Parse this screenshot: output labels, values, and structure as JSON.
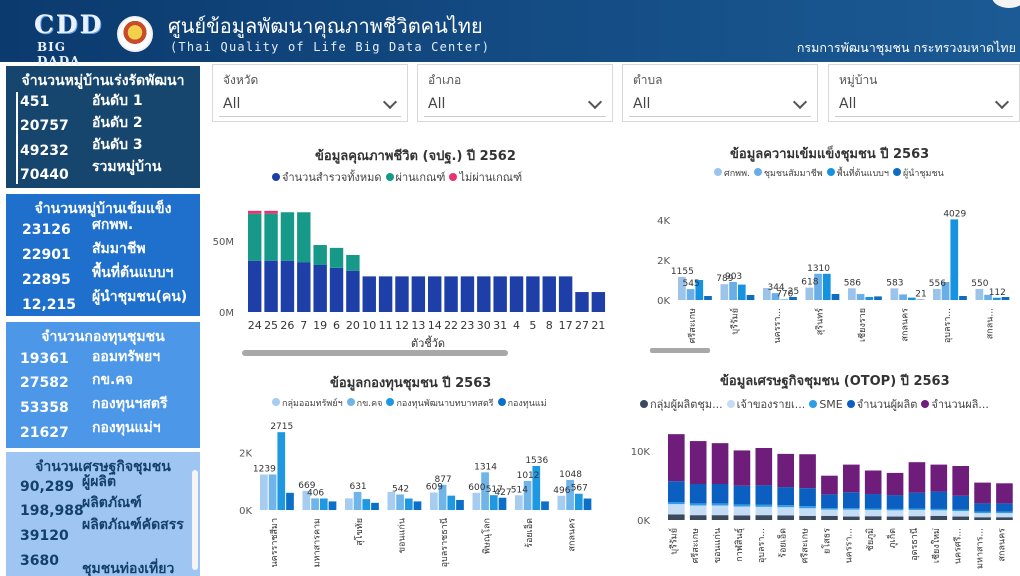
{
  "header": {
    "logo_text": "CDD",
    "logo_sub": "BIG DADA",
    "title": "ศูนย์ข้อมูลพัฒนาคุณภาพชีวิตคนไทย",
    "subtitle": "(Thai Quality of Life Big Data Center)",
    "department": "กรมการพัฒนาชุมชน กระทรวงมหาดไทย",
    "colors": {
      "header_bg": "#0b3a6e",
      "panel1": "#16456d",
      "panel2": "#1f6fcd",
      "panel3": "#4d97e8",
      "panel4": "#9fc6f2"
    }
  },
  "panels": [
    {
      "title": "จำนวนหมู่บ้านเร่งรัดพัฒนา",
      "rows": [
        {
          "num": "451",
          "label": "อันดับ 1"
        },
        {
          "num": "20757",
          "label": "อันดับ 2"
        },
        {
          "num": "49232",
          "label": "อันดับ 3"
        },
        {
          "num": "70440",
          "label": "รวมหมู่บ้าน"
        }
      ]
    },
    {
      "title": "จำนวนหมู่บ้านเข้มแข็ง",
      "rows": [
        {
          "num": "23126",
          "label": "ศกพพ."
        },
        {
          "num": "22901",
          "label": "สัมมาชีพ"
        },
        {
          "num": "22895",
          "label": "พื้นที่ต้นแบบฯ"
        },
        {
          "num": "12,215",
          "label": "ผู้นำชุมชน(คน)"
        }
      ]
    },
    {
      "title": "จำนวนกองทุนชุมชน",
      "rows": [
        {
          "num": "19361",
          "label": "ออมทรัพยฯ"
        },
        {
          "num": "27582",
          "label": "กข.คจ"
        },
        {
          "num": "53358",
          "label": "กองทุนฯสตรี"
        },
        {
          "num": "21627",
          "label": "กองทุนแม่ฯ"
        }
      ]
    },
    {
      "title": "จำนวนเศรษฐกิจชุมชน",
      "rows": [
        {
          "num": "90,289",
          "label": "ผู้ผลิต"
        },
        {
          "num": "198,988",
          "label": "ผลิตภัณฑ์"
        },
        {
          "num": "39120",
          "label": "ผลิตภัณฑ์คัดสรร"
        },
        {
          "num": "3680",
          "label": "ชุมชนท่องเที่ยว"
        }
      ]
    }
  ],
  "slicers": [
    {
      "title": "จังหวัด",
      "value": "All"
    },
    {
      "title": "อำเภอ",
      "value": "All"
    },
    {
      "title": "ตำบล",
      "value": "All"
    },
    {
      "title": "หมู่บ้าน",
      "value": "All"
    }
  ],
  "chart_data": [
    {
      "type": "bar",
      "stacked": true,
      "title": "ข้อมูลคุณภาพชีวิต (จปฐ.) ปี 2562",
      "xlabel": "ตัวชี้วัด",
      "yticks": [
        "0M",
        "50M"
      ],
      "ylim": [
        0,
        80
      ],
      "categories": [
        "24",
        "25",
        "26",
        "7",
        "19",
        "6",
        "20",
        "10",
        "11",
        "12",
        "13",
        "14",
        "22",
        "23",
        "30",
        "31",
        "4",
        "5",
        "8",
        "17",
        "27",
        "21"
      ],
      "series": [
        {
          "name": "จำนวนสำรวจทั้งหมด",
          "color": "#1f3fa8",
          "values": [
            36,
            36,
            36,
            35,
            33,
            31,
            29,
            25,
            25,
            25,
            25,
            25,
            25,
            25,
            25,
            25,
            25,
            25,
            25,
            25,
            14,
            14
          ]
        },
        {
          "name": "ผ่านเกณฑ์",
          "color": "#17998a",
          "values": [
            33,
            33,
            34,
            35,
            14,
            14,
            11,
            0,
            0,
            0,
            0,
            0,
            0,
            0,
            0,
            0,
            0,
            0,
            0,
            0,
            0,
            0
          ]
        },
        {
          "name": "ไม่ผ่านเกณฑ์",
          "color": "#e8336d",
          "values": [
            2,
            2,
            0,
            0,
            0,
            0,
            0,
            0,
            0,
            0,
            0,
            0,
            0,
            0,
            0,
            0,
            0,
            0,
            0,
            0,
            0,
            0
          ]
        }
      ]
    },
    {
      "type": "bar",
      "title": "ข้อมูลความเข้มแข็งชุมชน ปี 2563",
      "yticks": [
        "0K",
        "2K",
        "4K"
      ],
      "ylim": [
        0,
        4500
      ],
      "categories": [
        "ศรีสะเกษ",
        "บุรีรัมย์",
        "นครรา...",
        "สุรินทร์",
        "เชียงราย",
        "สกลนคร",
        "อุบลรา...",
        "สกลน..."
      ],
      "series": [
        {
          "name": "ศกพพ.",
          "color": "#9cc3ea",
          "values": [
            1155,
            789,
            600,
            618,
            586,
            583,
            556,
            550
          ]
        },
        {
          "name": "ชุมชนสัมมาชีพ",
          "color": "#6aaee8",
          "values": [
            545,
            903,
            344,
            1310,
            300,
            280,
            900,
            260
          ]
        },
        {
          "name": "พื้นที่ต้นแบบฯ",
          "color": "#1593e0",
          "values": [
            1000,
            770,
            25,
            1310,
            150,
            120,
            4029,
            112
          ]
        },
        {
          "name": "ผู้นำชุมชน",
          "color": "#0f6cc0",
          "values": [
            200,
            250,
            150,
            300,
            180,
            21,
            200,
            150
          ]
        }
      ],
      "data_labels": [
        "1155",
        "545",
        "789",
        "903",
        "344",
        "770",
        "25",
        "618",
        "1310",
        "586",
        "583",
        "21",
        "556",
        "4029",
        "550",
        "112"
      ]
    },
    {
      "type": "bar",
      "title": "ข้อมูลกองทุนชุมชน ปี 2563",
      "yticks": [
        "0K",
        "2K"
      ],
      "ylim": [
        0,
        3000
      ],
      "categories": [
        "นครราชสีมา",
        "มหาสารคาม",
        "สุโขทัย",
        "ขอนแก่น",
        "อุบลราชธานี",
        "พิษณุโลก",
        "ร้อยเอ็ด",
        "สกลนคร"
      ],
      "series": [
        {
          "name": "กลุ่มออมทรัพย์ฯ",
          "color": "#a6cdf0",
          "values": [
            1239,
            669,
            406,
            631,
            609,
            600,
            514,
            496
          ]
        },
        {
          "name": "กข.คจ",
          "color": "#6fb5ea",
          "values": [
            1239,
            406,
            631,
            542,
            877,
            1314,
            1012,
            1048
          ]
        },
        {
          "name": "กองทุนพัฒนาบทบาทสตรี",
          "color": "#1f98e2",
          "values": [
            2715,
            400,
            380,
            400,
            500,
            517,
            1536,
            567
          ]
        },
        {
          "name": "กองทุนแม่",
          "color": "#0c6fc8",
          "values": [
            600,
            300,
            250,
            300,
            350,
            427,
            300,
            400
          ]
        }
      ],
      "data_labels": [
        "1239",
        "2715",
        "669",
        "406",
        "631",
        "542",
        "609",
        "877",
        "600",
        "1314",
        "517",
        "427",
        "514",
        "1012",
        "1536",
        "496",
        "1048",
        "567"
      ]
    },
    {
      "type": "bar",
      "stacked": true,
      "title": "ข้อมูลเศรษฐกิจชุมชน (OTOP) ปี 2563",
      "yticks": [
        "0K",
        "10K"
      ],
      "ylim": [
        0,
        13000
      ],
      "categories": [
        "บุรีรัมย์",
        "ศรีสะเกษ",
        "ขอนแก่น",
        "กาฬสินธุ์",
        "อุบลรา...",
        "ร้อยเอ็ด",
        "ศรีสะเกษ",
        "ยโสธร",
        "นครรา...",
        "ชัยภูมิ",
        "ภูเก็ต",
        "อุดรธานี",
        "เชียงใหม่",
        "นครศรี...",
        "มหาสาร...",
        "สกลนคร"
      ],
      "series": [
        {
          "name": "กลุ่มผู้ผลิตชุม...",
          "color": "#3a4a5c",
          "values": [
            800,
            700,
            700,
            650,
            700,
            650,
            600,
            600,
            500,
            550,
            500,
            550,
            600,
            500,
            400,
            400
          ]
        },
        {
          "name": "เจ้าของรายเ...",
          "color": "#c4dcf5",
          "values": [
            1500,
            1400,
            1400,
            1300,
            1200,
            1200,
            1100,
            900,
            1000,
            900,
            900,
            900,
            800,
            800,
            600,
            600
          ]
        },
        {
          "name": "SME",
          "color": "#2f9de6",
          "values": [
            300,
            300,
            300,
            300,
            300,
            300,
            300,
            200,
            200,
            200,
            200,
            200,
            200,
            200,
            200,
            200
          ]
        },
        {
          "name": "จำนวนผู้ผลิต",
          "color": "#0a5fc0",
          "values": [
            3000,
            2800,
            2800,
            2700,
            2800,
            2600,
            2600,
            2000,
            2300,
            2100,
            2000,
            2300,
            2500,
            2000,
            1200,
            1200
          ]
        },
        {
          "name": "จำนวนผลิ...",
          "color": "#6e1d7a",
          "values": [
            6800,
            6200,
            5900,
            5100,
            5400,
            4800,
            4900,
            2700,
            4000,
            3400,
            3200,
            4400,
            3900,
            4300,
            3000,
            2900
          ]
        }
      ]
    }
  ]
}
